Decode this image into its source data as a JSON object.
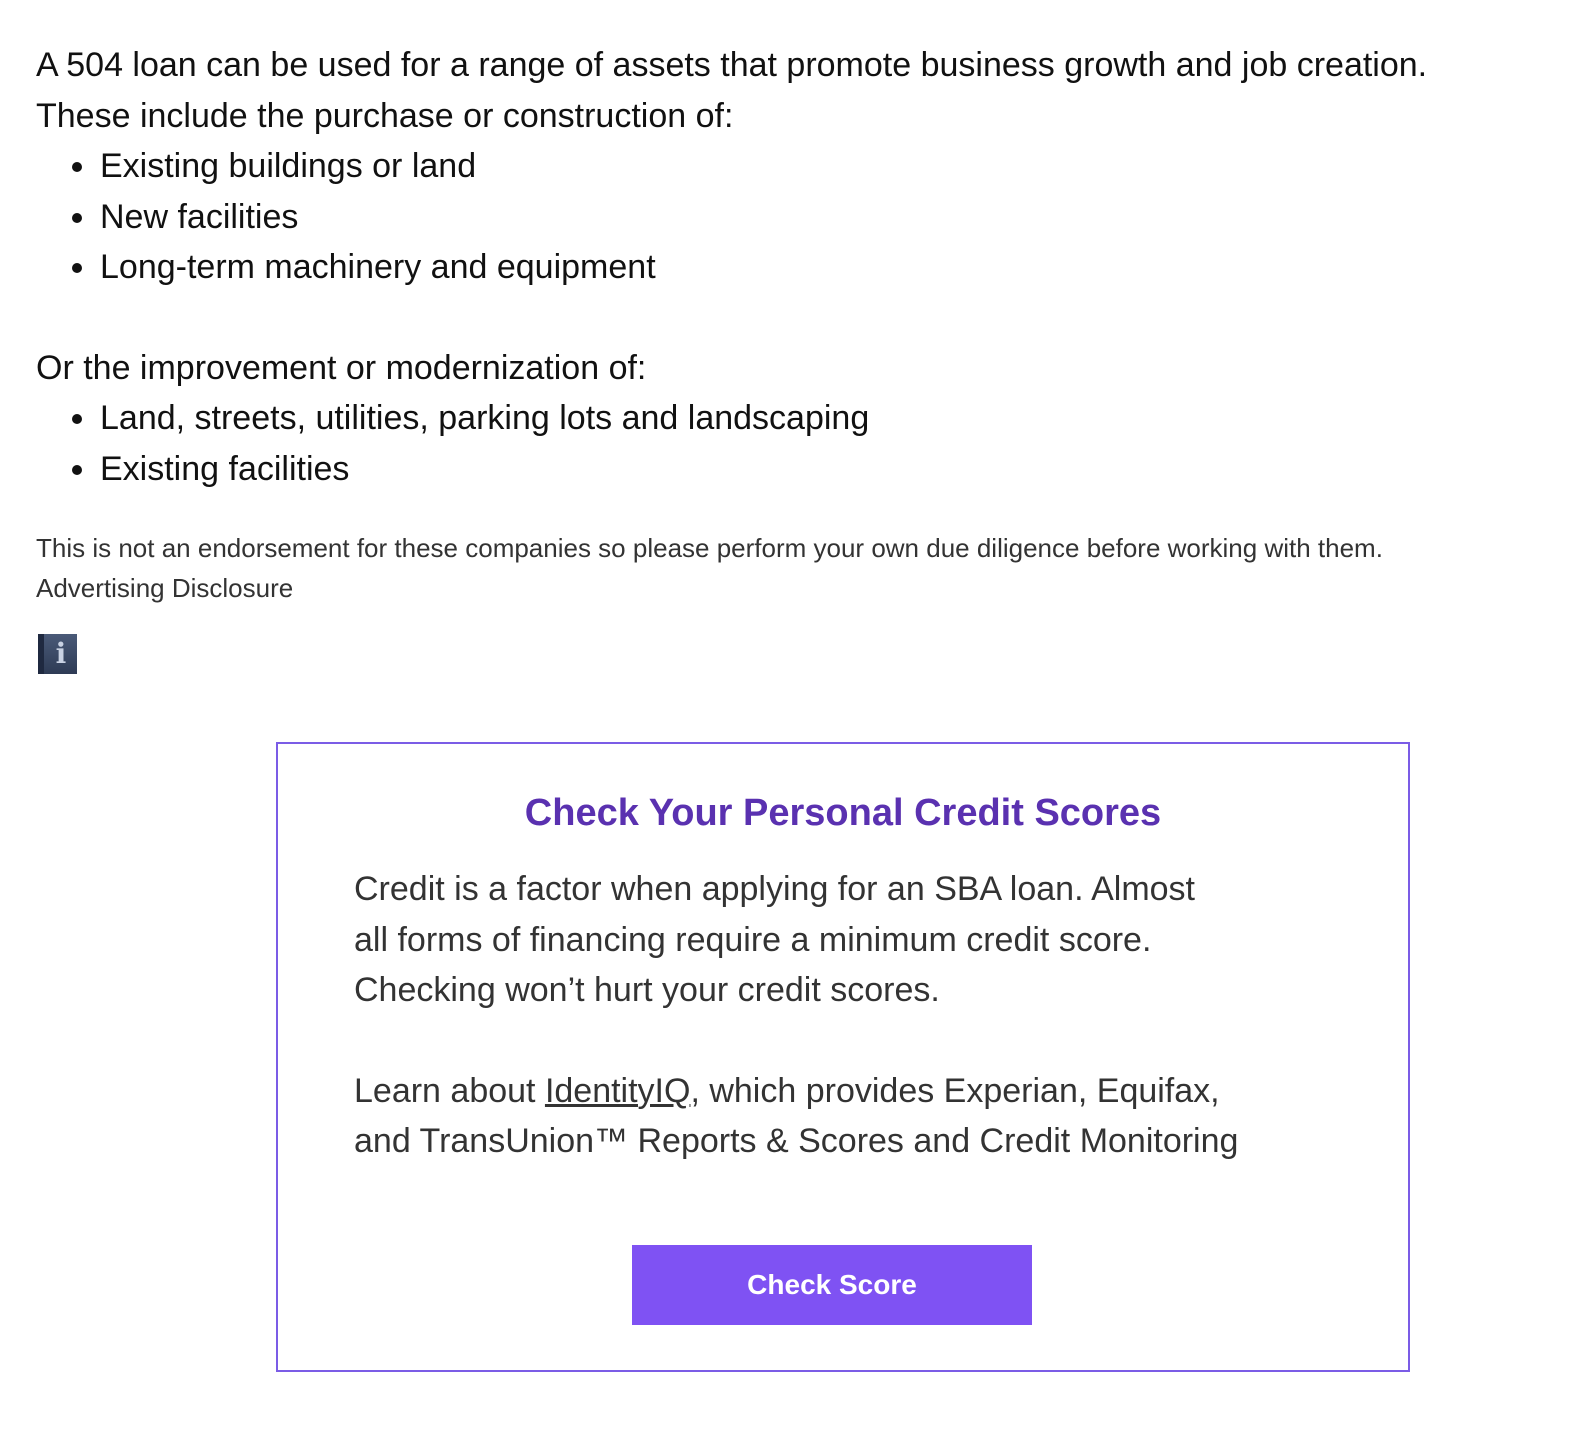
{
  "intro": {
    "line1": "A 504 loan  can be used for a range of assets that promote business growth and job creation.",
    "line2": "These include the purchase or construction of:"
  },
  "purchase_items": [
    "Existing buildings or land",
    "New facilities",
    "Long-term machinery and equipment"
  ],
  "improvement": {
    "heading": "Or the improvement or modernization of:"
  },
  "improvement_items": [
    "Land, streets, utilities, parking lots and landscaping",
    "Existing facilities"
  ],
  "disclaimer": {
    "text": "This is not an endorsement for these companies so please perform your own due diligence before working with them.",
    "link": "Advertising Disclosure"
  },
  "icons": {
    "info": "info-icon",
    "info_glyph": "i"
  },
  "credit_box": {
    "title": "Check Your Personal Credit Scores",
    "body_line1": "Credit is a factor when applying for an SBA loan. Almost",
    "body_line2": "all forms of financing require a minimum credit score.",
    "body_line3": "Checking won’t hurt your credit scores.",
    "learn_prefix": "Learn about ",
    "learn_link": "IdentityIQ",
    "learn_suffix": ", which provides Experian, Equifax,",
    "learn_line2": "and TransUnion™ Reports & Scores and Credit Monitoring",
    "button_label": "Check Score"
  },
  "colors": {
    "box_border": "#7b5ce6",
    "title": "#5a31b0",
    "button_bg": "#7f52f3",
    "button_text": "#ffffff"
  }
}
